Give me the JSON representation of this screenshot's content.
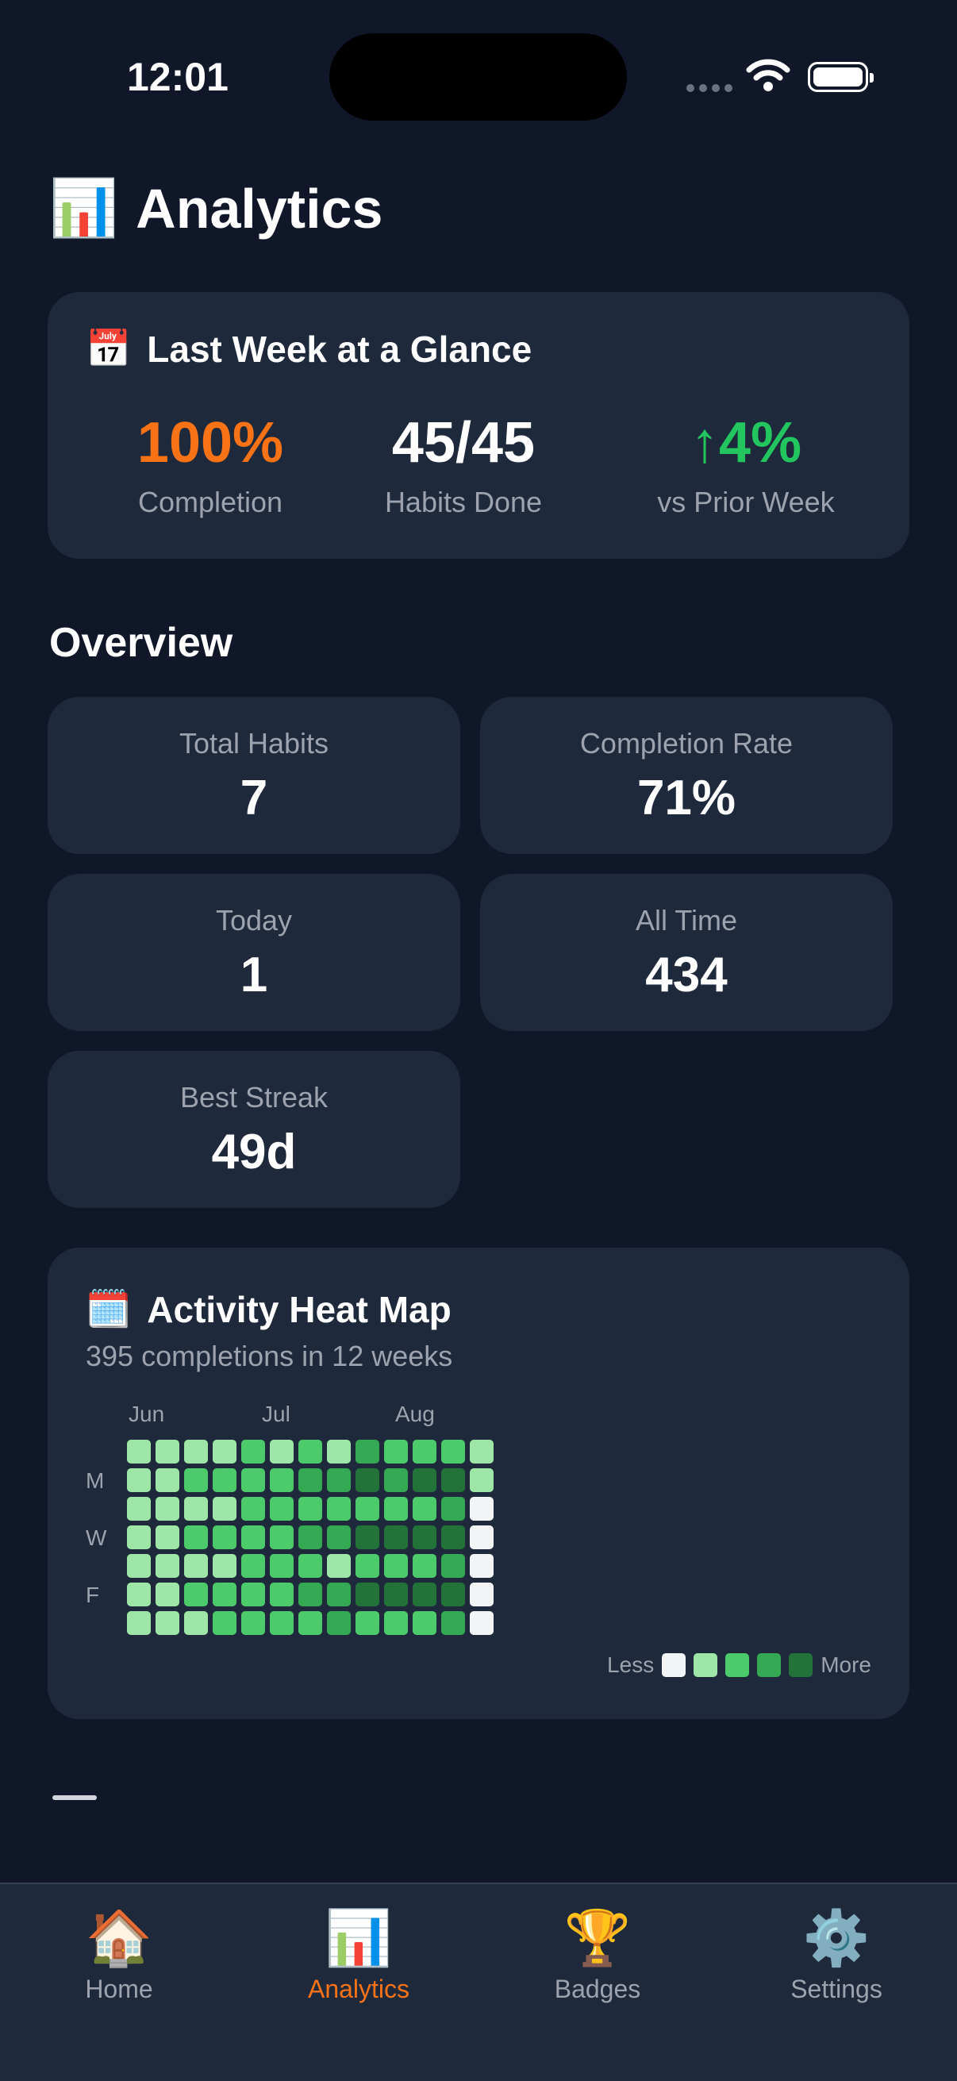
{
  "status_bar": {
    "time": "12:01"
  },
  "header": {
    "icon": "📊",
    "title": "Analytics"
  },
  "week_summary": {
    "icon": "📅",
    "title": "Last Week at a Glance",
    "stats": [
      {
        "value": "100%",
        "label": "Completion",
        "color": "#f97316"
      },
      {
        "value": "45/45",
        "label": "Habits Done",
        "color": "#ffffff"
      },
      {
        "value": "↑4%",
        "label": "vs Prior Week",
        "color": "#22c55e"
      }
    ]
  },
  "overview": {
    "title": "Overview",
    "tiles": [
      {
        "label": "Total Habits",
        "value": "7"
      },
      {
        "label": "Completion Rate",
        "value": "71%"
      },
      {
        "label": "Today",
        "value": "1"
      },
      {
        "label": "All Time",
        "value": "434"
      },
      {
        "label": "Best Streak",
        "value": "49d"
      }
    ]
  },
  "heatmap": {
    "icon": "🗓️",
    "title": "Activity Heat Map",
    "subtitle": "395 completions in 12 weeks",
    "months": [
      "Jun",
      "Jul",
      "Aug"
    ],
    "day_labels": [
      "M",
      "W",
      "F"
    ],
    "legend_less": "Less",
    "legend_more": "More",
    "palette": [
      "#f3f4f6",
      "#9ee6a8",
      "#4ccb6b",
      "#34a853",
      "#23723a"
    ],
    "weeks": [
      [
        1,
        1,
        1,
        1,
        1,
        1,
        1
      ],
      [
        1,
        1,
        1,
        1,
        1,
        1,
        1
      ],
      [
        1,
        2,
        1,
        2,
        1,
        2,
        1
      ],
      [
        1,
        2,
        1,
        2,
        1,
        2,
        2
      ],
      [
        2,
        2,
        2,
        2,
        2,
        2,
        2
      ],
      [
        1,
        2,
        2,
        2,
        2,
        2,
        2
      ],
      [
        2,
        3,
        2,
        3,
        2,
        3,
        2
      ],
      [
        1,
        3,
        2,
        3,
        1,
        3,
        3
      ],
      [
        3,
        4,
        2,
        4,
        2,
        4,
        2
      ],
      [
        2,
        3,
        2,
        4,
        2,
        4,
        2
      ],
      [
        2,
        4,
        2,
        4,
        2,
        4,
        2
      ],
      [
        2,
        4,
        3,
        4,
        3,
        4,
        3
      ],
      [
        1,
        1,
        0,
        0,
        0,
        0,
        0
      ]
    ]
  },
  "tabs": [
    {
      "icon": "🏠",
      "label": "Home",
      "active": false
    },
    {
      "icon": "📊",
      "label": "Analytics",
      "active": true
    },
    {
      "icon": "🏆",
      "label": "Badges",
      "active": false
    },
    {
      "icon": "⚙️",
      "label": "Settings",
      "active": false
    }
  ]
}
